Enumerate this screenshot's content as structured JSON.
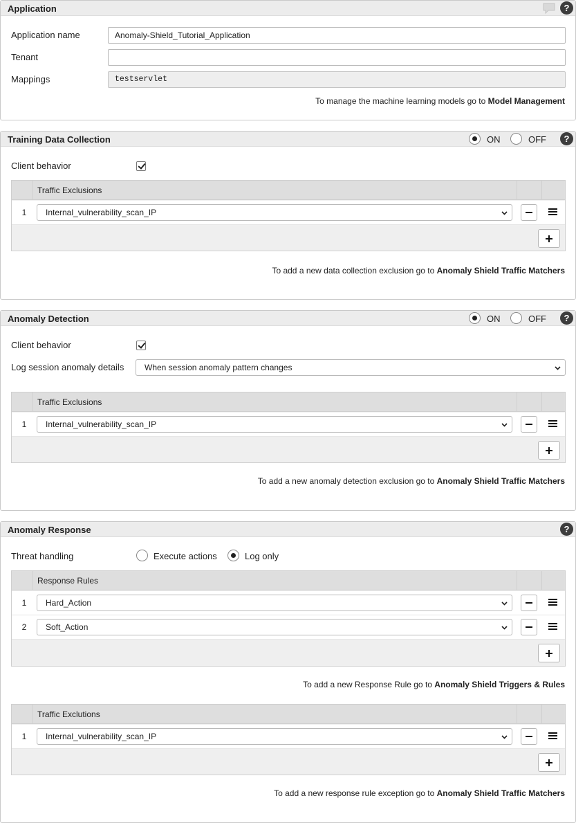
{
  "application": {
    "title": "Application",
    "help": "?",
    "fields": {
      "name_label": "Application name",
      "name_value": "Anomaly-Shield_Tutorial_Application",
      "tenant_label": "Tenant",
      "tenant_value": "",
      "mappings_label": "Mappings",
      "mappings_value": "testservlet"
    },
    "note_text": "To manage the machine learning models go to ",
    "note_link": "Model Management"
  },
  "training": {
    "title": "Training Data Collection",
    "on_label": "ON",
    "off_label": "OFF",
    "state": "ON",
    "help": "?",
    "client_behavior_label": "Client behavior",
    "client_behavior_checked": true,
    "table": {
      "header": "Traffic Exclusions",
      "rows": [
        {
          "num": "1",
          "value": "Internal_vulnerability_scan_IP"
        }
      ]
    },
    "note_text": "To add a new data collection exclusion go to ",
    "note_link": "Anomaly Shield Traffic Matchers"
  },
  "detection": {
    "title": "Anomaly Detection",
    "on_label": "ON",
    "off_label": "OFF",
    "state": "ON",
    "help": "?",
    "client_behavior_label": "Client behavior",
    "client_behavior_checked": true,
    "log_label": "Log session anomaly details",
    "log_value": "When session anomaly pattern changes",
    "table": {
      "header": "Traffic Exclusions",
      "rows": [
        {
          "num": "1",
          "value": "Internal_vulnerability_scan_IP"
        }
      ]
    },
    "note_text": "To add a new anomaly detection exclusion go to ",
    "note_link": "Anomaly Shield Traffic Matchers"
  },
  "response": {
    "title": "Anomaly Response",
    "help": "?",
    "threat_label": "Threat handling",
    "execute_label": "Execute actions",
    "log_only_label": "Log only",
    "threat_selected": "Log only",
    "rules_table": {
      "header": "Response Rules",
      "rows": [
        {
          "num": "1",
          "value": "Hard_Action"
        },
        {
          "num": "2",
          "value": "Soft_Action"
        }
      ]
    },
    "rules_note_text": "To add a new Response Rule go to ",
    "rules_note_link": "Anomaly Shield Triggers & Rules",
    "excl_table": {
      "header": "Traffic Exclutions",
      "rows": [
        {
          "num": "1",
          "value": "Internal_vulnerability_scan_IP"
        }
      ]
    },
    "excl_note_text": "To add a new response rule exception go to ",
    "excl_note_link": "Anomaly Shield Traffic Matchers"
  },
  "colors": {
    "header_bg": "#ececec",
    "table_header_bg": "#dedede",
    "help_icon_bg": "#3d3d3d"
  }
}
